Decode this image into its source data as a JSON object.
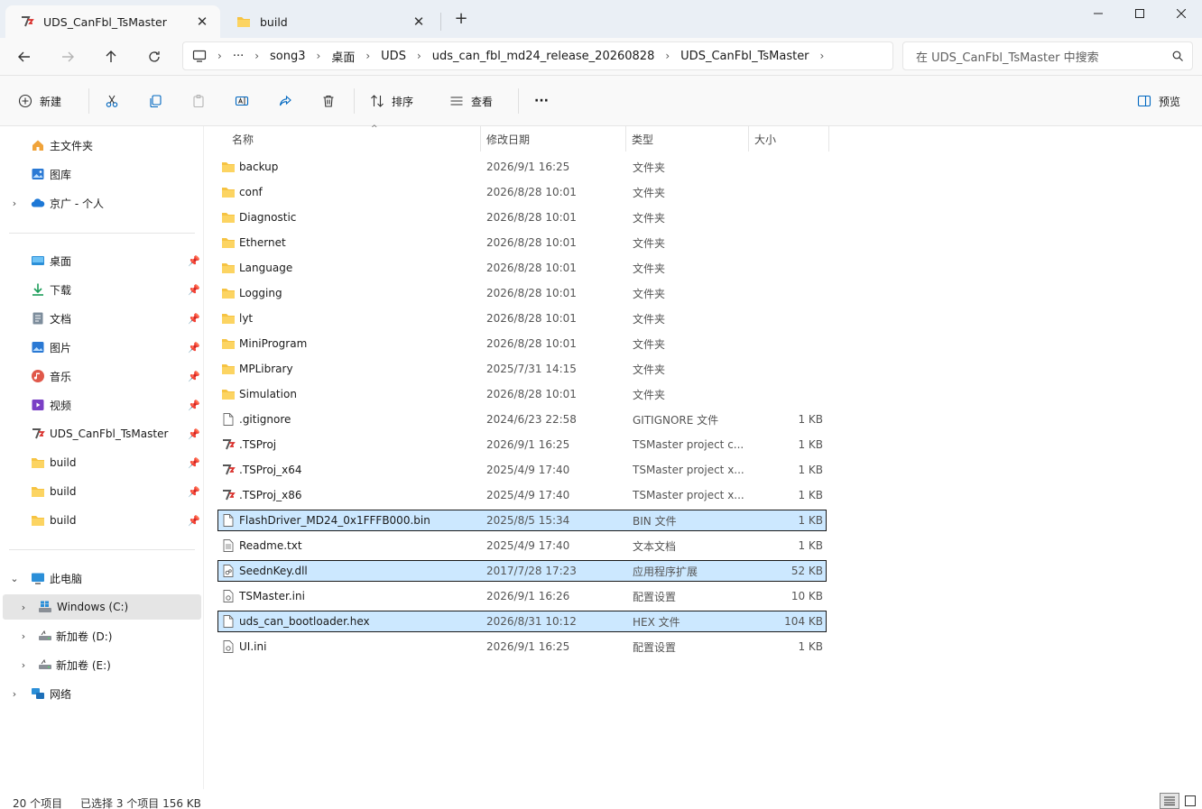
{
  "tabs": [
    {
      "label": "UDS_CanFbl_TsMaster",
      "icon": "tsmaster-icon",
      "active": true
    },
    {
      "label": "build",
      "icon": "folder-icon",
      "active": false
    }
  ],
  "new_tab_label": "+",
  "close_label": "✕",
  "address": {
    "breadcrumbs": [
      "···",
      "song3",
      "桌面",
      "UDS",
      "uds_can_fbl_md24_release_20260828",
      "UDS_CanFbl_TsMaster"
    ],
    "search_placeholder": "在 UDS_CanFbl_TsMaster 中搜索"
  },
  "toolbar": {
    "new_label": "新建",
    "sort_label": "排序",
    "view_label": "查看",
    "more_label": "···",
    "preview_label": "预览"
  },
  "nav": {
    "pinned_top": [
      {
        "label": "主文件夹",
        "icon": "home-icon"
      },
      {
        "label": "图库",
        "icon": "gallery-icon"
      },
      {
        "label": "京广 - 个人",
        "icon": "onedrive-icon"
      }
    ],
    "quick": [
      {
        "label": "桌面",
        "icon": "desktop-icon"
      },
      {
        "label": "下载",
        "icon": "download-icon"
      },
      {
        "label": "文档",
        "icon": "document-icon"
      },
      {
        "label": "图片",
        "icon": "pictures-icon"
      },
      {
        "label": "音乐",
        "icon": "music-icon"
      },
      {
        "label": "视频",
        "icon": "video-icon"
      },
      {
        "label": "UDS_CanFbl_TsMaster",
        "icon": "tsmaster-icon"
      },
      {
        "label": "build",
        "icon": "folder-icon"
      },
      {
        "label": "build",
        "icon": "folder-icon"
      },
      {
        "label": "build",
        "icon": "folder-icon"
      }
    ],
    "pc": {
      "label": "此电脑",
      "icon": "pc-icon"
    },
    "drives": [
      {
        "label": "Windows (C:)",
        "icon": "windows-drive-icon"
      },
      {
        "label": "新加卷 (D:)",
        "icon": "drive-icon"
      },
      {
        "label": "新加卷 (E:)",
        "icon": "drive-icon"
      }
    ],
    "network": {
      "label": "网络",
      "icon": "network-icon"
    }
  },
  "columns": {
    "name": "名称",
    "date": "修改日期",
    "type": "类型",
    "size": "大小"
  },
  "files": [
    {
      "name": "backup",
      "date": "2026/9/1 16:25",
      "type": "文件夹",
      "size": "",
      "icon": "folder"
    },
    {
      "name": "conf",
      "date": "2026/8/28 10:01",
      "type": "文件夹",
      "size": "",
      "icon": "folder"
    },
    {
      "name": "Diagnostic",
      "date": "2026/8/28 10:01",
      "type": "文件夹",
      "size": "",
      "icon": "folder"
    },
    {
      "name": "Ethernet",
      "date": "2026/8/28 10:01",
      "type": "文件夹",
      "size": "",
      "icon": "folder"
    },
    {
      "name": "Language",
      "date": "2026/8/28 10:01",
      "type": "文件夹",
      "size": "",
      "icon": "folder"
    },
    {
      "name": "Logging",
      "date": "2026/8/28 10:01",
      "type": "文件夹",
      "size": "",
      "icon": "folder"
    },
    {
      "name": "lyt",
      "date": "2026/8/28 10:01",
      "type": "文件夹",
      "size": "",
      "icon": "folder"
    },
    {
      "name": "MiniProgram",
      "date": "2026/8/28 10:01",
      "type": "文件夹",
      "size": "",
      "icon": "folder"
    },
    {
      "name": "MPLibrary",
      "date": "2025/7/31 14:15",
      "type": "文件夹",
      "size": "",
      "icon": "folder"
    },
    {
      "name": "Simulation",
      "date": "2026/8/28 10:01",
      "type": "文件夹",
      "size": "",
      "icon": "folder"
    },
    {
      "name": ".gitignore",
      "date": "2024/6/23 22:58",
      "type": "GITIGNORE 文件",
      "size": "1 KB",
      "icon": "file"
    },
    {
      "name": ".TSProj",
      "date": "2026/9/1 16:25",
      "type": "TSMaster project c...",
      "size": "1 KB",
      "icon": "ts"
    },
    {
      "name": ".TSProj_x64",
      "date": "2025/4/9 17:40",
      "type": "TSMaster project x...",
      "size": "1 KB",
      "icon": "ts"
    },
    {
      "name": ".TSProj_x86",
      "date": "2025/4/9 17:40",
      "type": "TSMaster project x...",
      "size": "1 KB",
      "icon": "ts"
    },
    {
      "name": "FlashDriver_MD24_0x1FFFB000.bin",
      "date": "2025/8/5 15:34",
      "type": "BIN 文件",
      "size": "1 KB",
      "icon": "file",
      "selected": true
    },
    {
      "name": "Readme.txt",
      "date": "2025/4/9 17:40",
      "type": "文本文档",
      "size": "1 KB",
      "icon": "text"
    },
    {
      "name": "SeednKey.dll",
      "date": "2017/7/28 17:23",
      "type": "应用程序扩展",
      "size": "52 KB",
      "icon": "dll",
      "selected": true
    },
    {
      "name": "TSMaster.ini",
      "date": "2026/9/1 16:26",
      "type": "配置设置",
      "size": "10 KB",
      "icon": "ini"
    },
    {
      "name": "uds_can_bootloader.hex",
      "date": "2026/8/31 10:12",
      "type": "HEX 文件",
      "size": "104 KB",
      "icon": "file",
      "selected": true
    },
    {
      "name": "UI.ini",
      "date": "2026/9/1 16:25",
      "type": "配置设置",
      "size": "1 KB",
      "icon": "ini"
    }
  ],
  "status": {
    "count": "20 个项目",
    "selection": "已选择 3 个项目  156 KB"
  },
  "colors": {
    "selection": "#cce8ff",
    "folder": "#f6c342",
    "accent": "#0067c0"
  }
}
